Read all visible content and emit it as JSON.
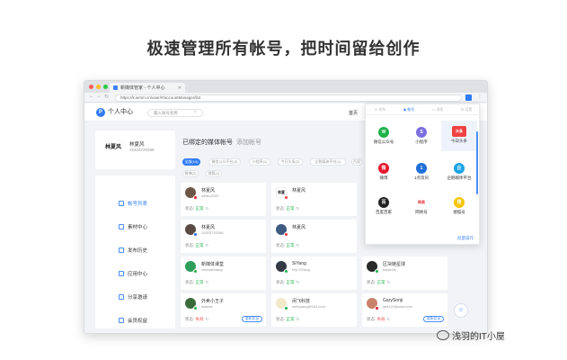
{
  "headline": "极速管理所有帐号，把时间留给创作",
  "browser": {
    "tab_title": "新媒体管家 - 个人中心",
    "url": "https://k.wmm.cn/user/#/accountManager/list",
    "dot_colors": [
      "#fe5f57",
      "#febc2e",
      "#28c840"
    ]
  },
  "header": {
    "logo_letter": "P",
    "title": "个人中心",
    "search_placeholder": "输入账号名称",
    "home_link": "首页"
  },
  "user": {
    "signature": "林夏风",
    "name": "林夏风",
    "id": "15303720288"
  },
  "sidebar": {
    "items": [
      {
        "label": "帐号列表"
      },
      {
        "label": "素材中心"
      },
      {
        "label": "发布历史"
      },
      {
        "label": "应用中心"
      },
      {
        "label": "分享邀请"
      },
      {
        "label": "会员权益"
      }
    ]
  },
  "main": {
    "tab_bound": "已绑定的媒体帐号",
    "tab_add": "添加帐号",
    "filters": [
      "全部(14)",
      "微信公众平台(3)",
      "小程序(1)",
      "今日头条(2)",
      "企鹅媒体平台(1)",
      "百家号(2)",
      "微博(2)",
      "搜狐(1)"
    ]
  },
  "cards": [
    {
      "name": "林夏风",
      "sub": "weibo2020",
      "status_label": "状态:",
      "status": "正常",
      "ok": true
    },
    {
      "name": "林夏风",
      "sub": "",
      "status_label": "状态:",
      "status": "正常",
      "ok": true
    },
    {
      "name": "林夏风",
      "sub": "15303720288",
      "status_label": "状态:",
      "status": "正常",
      "ok": true
    },
    {
      "name": "林夏风",
      "sub": "",
      "status_label": "状态:",
      "status": "正常",
      "ok": true
    },
    {
      "name": "新媒体课堂",
      "sub": "xinmeiketang",
      "status_label": "状态:",
      "status": "正常",
      "ok": true
    },
    {
      "name": "SiYang",
      "sub": "Wy-SiYang",
      "status_label": "状态:",
      "status": "正常",
      "ok": true
    },
    {
      "name": "区块链星球",
      "sub": "biqxinhe",
      "status_label": "状态:",
      "status": "正常",
      "ok": true
    },
    {
      "name": "外卖小王子",
      "sub": "waimai",
      "status_label": "状态:",
      "status": "失效",
      "ok": false,
      "action": "重新登录"
    },
    {
      "name": "闲飞科技",
      "sub": "weixiyang@163.com",
      "status_label": "状态:",
      "status": "正常",
      "ok": true
    },
    {
      "name": "GarySonji",
      "sub": "alxt123@sina.com",
      "status_label": "状态:",
      "status": "失效",
      "ok": false,
      "action": "重新登录"
    }
  ],
  "popup": {
    "tabs": [
      "发布",
      "帐号",
      "消息",
      "设置"
    ],
    "items": [
      {
        "label": "微信公众号",
        "color": "#20b24a",
        "glyph": "W"
      },
      {
        "label": "小程序",
        "color": "#7b6fe0",
        "glyph": "S"
      },
      {
        "label": "今日头条",
        "color": "#f04142",
        "glyph": "头条"
      },
      {
        "label": "微博",
        "color": "#e6162d",
        "glyph": "微"
      },
      {
        "label": "1点资讯",
        "color": "#1e6fd9",
        "glyph": "1"
      },
      {
        "label": "企鹅媒体平台",
        "color": "#1aa4e6",
        "glyph": "企"
      },
      {
        "label": "百度百家",
        "color": "#222222",
        "glyph": "百"
      },
      {
        "label": "网易号",
        "color": "#e8303b",
        "glyph": "网易"
      },
      {
        "label": "搜狐号",
        "color": "#f5c400",
        "glyph": "搜"
      }
    ],
    "footer": "批量操作"
  },
  "watermark": "浅羽的IT小屋"
}
